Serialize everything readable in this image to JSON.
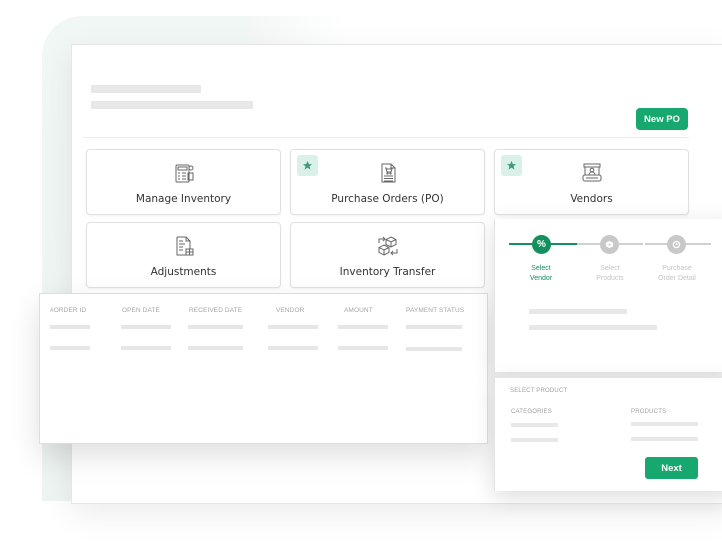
{
  "header": {
    "new_po_label": "New PO"
  },
  "tiles": [
    {
      "label": "Manage Inventory",
      "icon": "inventory-calculator-icon",
      "starred": false
    },
    {
      "label": "Purchase Orders (PO)",
      "icon": "purchase-order-cart-icon",
      "starred": true
    },
    {
      "label": "Vendors",
      "icon": "vendor-stall-icon",
      "starred": true
    },
    {
      "label": "Adjustments",
      "icon": "adjustments-document-icon",
      "starred": false
    },
    {
      "label": "Inventory Transfer",
      "icon": "inventory-transfer-boxes-icon",
      "starred": false
    }
  ],
  "orders_table": {
    "columns": [
      "#ORDER ID",
      "OPEN DATE",
      "RECEIVED DATE",
      "VENDOR",
      "AMOUNT",
      "PAYMENT STATUS"
    ]
  },
  "wizard": {
    "steps": [
      {
        "label_line1": "Select",
        "label_line2": "Vendor",
        "icon": "percent-icon",
        "state": "active"
      },
      {
        "label_line1": "Select",
        "label_line2": "Products",
        "icon": "box-heart-icon",
        "state": "inactive"
      },
      {
        "label_line1": "Purchase",
        "label_line2": "Order Detail",
        "icon": "clock-icon",
        "state": "inactive"
      }
    ],
    "active_color": "#14905f",
    "inactive_color": "#c8c8c8"
  },
  "product_select": {
    "title": "SELECT PRODUCT",
    "categories_label": "CATEGORIES",
    "products_label": "PRODUCTS",
    "next_label": "Next"
  },
  "colors": {
    "brand_green": "#16a86e",
    "star_bg": "#d9f1e8",
    "star_fg": "#3f9a7a"
  }
}
